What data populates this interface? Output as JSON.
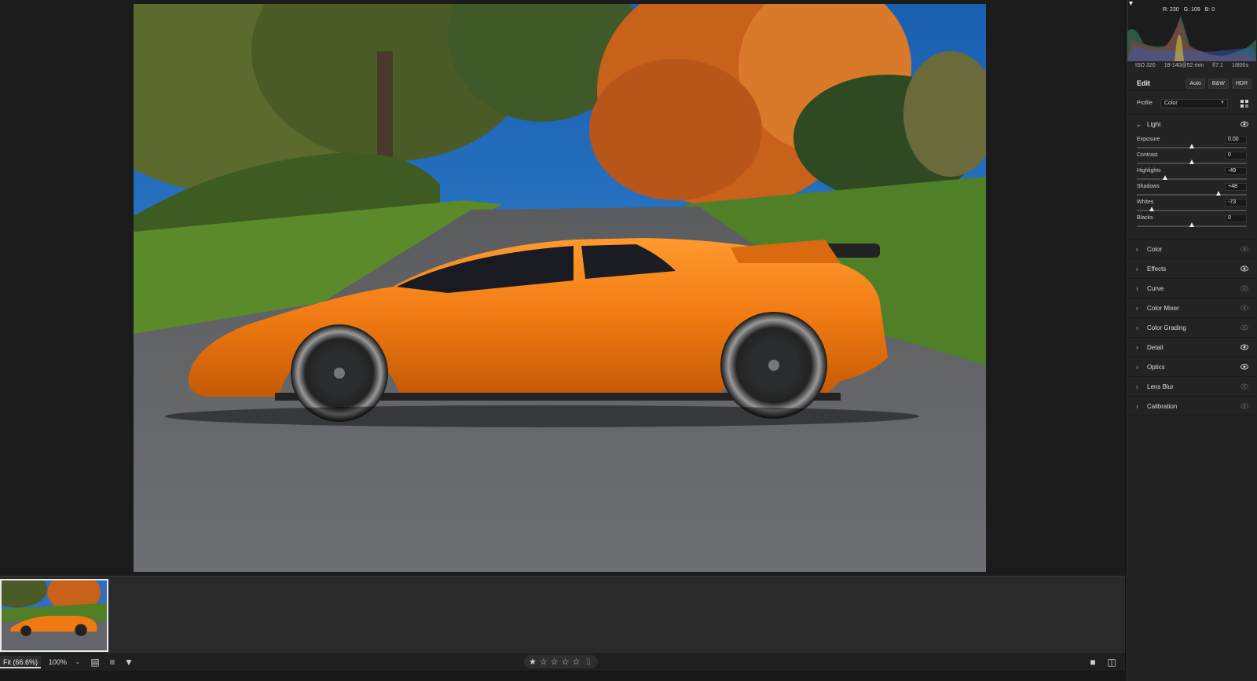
{
  "histogram": {
    "readout": {
      "r": "R: 230",
      "g": "G: 109",
      "b": "B: 0"
    }
  },
  "exif": {
    "iso": "ISO 320",
    "lens": "18-140@52 mm",
    "aperture": "f/7.1",
    "shutter": "1/800s"
  },
  "edit": {
    "title": "Edit",
    "buttons": {
      "auto": "Auto",
      "bw": "B&W",
      "hdr": "HDR"
    }
  },
  "profile": {
    "label": "Profile",
    "value": "Color"
  },
  "sections": {
    "light": "Light",
    "color": "Color",
    "effects": "Effects",
    "curve": "Curve",
    "color_mixer": "Color Mixer",
    "color_grading": "Color Grading",
    "detail": "Detail",
    "optics": "Optics",
    "lens_blur": "Lens Blur",
    "calibration": "Calibration"
  },
  "light_sliders": [
    {
      "name": "Exposure",
      "value": "0.00",
      "level": 0.5
    },
    {
      "name": "Contrast",
      "value": "0",
      "level": 0.5
    },
    {
      "name": "Highlights",
      "value": "-49",
      "level": 0.255
    },
    {
      "name": "Shadows",
      "value": "+48",
      "level": 0.74
    },
    {
      "name": "Whites",
      "value": "-73",
      "level": 0.135
    },
    {
      "name": "Blacks",
      "value": "0",
      "level": 0.5
    }
  ],
  "bottombar": {
    "fit": "Fit (66.6%)",
    "zoom": "100%"
  },
  "rating": {
    "stars": 5,
    "filled": 1
  },
  "colors": {
    "accent_car": "#f07a12",
    "panel_bg": "#232323"
  }
}
